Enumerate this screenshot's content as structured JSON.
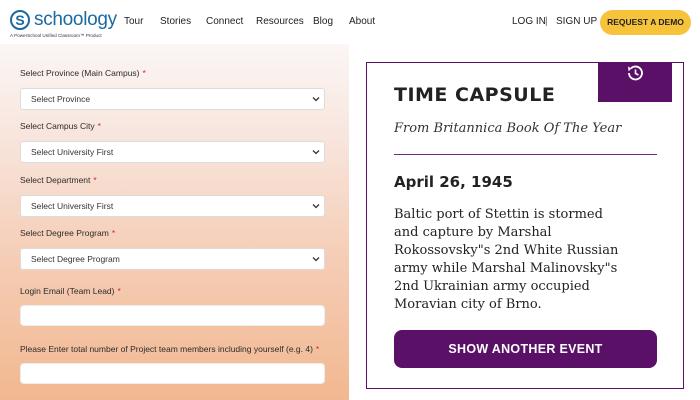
{
  "header": {
    "logo_text": "schoology",
    "logo_mark": "S",
    "logo_tagline": "A PowerSchool Unified Classroom™ Product",
    "nav": [
      "Tour",
      "Stories",
      "Connect",
      "Resources",
      "Blog",
      "About"
    ],
    "login": "LOG IN",
    "divider": "|",
    "signup": "SIGN UP",
    "demo_button": "REQUEST A DEMO",
    "demo_color": "#f6c33b"
  },
  "form": {
    "required_mark": "*",
    "fields": [
      {
        "label": "Select Province (Main Campus)",
        "type": "select",
        "value": "Select Province"
      },
      {
        "label": "Select Campus City",
        "type": "select",
        "value": "Select University First"
      },
      {
        "label": "Select Department",
        "type": "select",
        "value": "Select University First"
      },
      {
        "label": "Select Degree Program",
        "type": "select",
        "value": "Select Degree Program"
      },
      {
        "label": "Login Email (Team Lead)",
        "type": "input",
        "value": ""
      },
      {
        "label": "Please Enter total number of Project team members including yourself (e.g. 4)",
        "type": "input",
        "value": ""
      }
    ]
  },
  "capsule": {
    "title": "TIME CAPSULE",
    "subtitle": "From Britannica Book Of The Year",
    "date": "April 26, 1945",
    "body_lines": [
      "Baltic port of Stettin is stormed",
      "and capture by Marshal",
      "Rokossovsky\"s 2nd White Russian",
      "army while Marshal Malinovsky\"s",
      "2nd Ukrainian army occupied",
      "Moravian city of Brno."
    ],
    "button": "SHOW ANOTHER EVENT",
    "accent": "#5b1068",
    "icon": "history-icon"
  }
}
